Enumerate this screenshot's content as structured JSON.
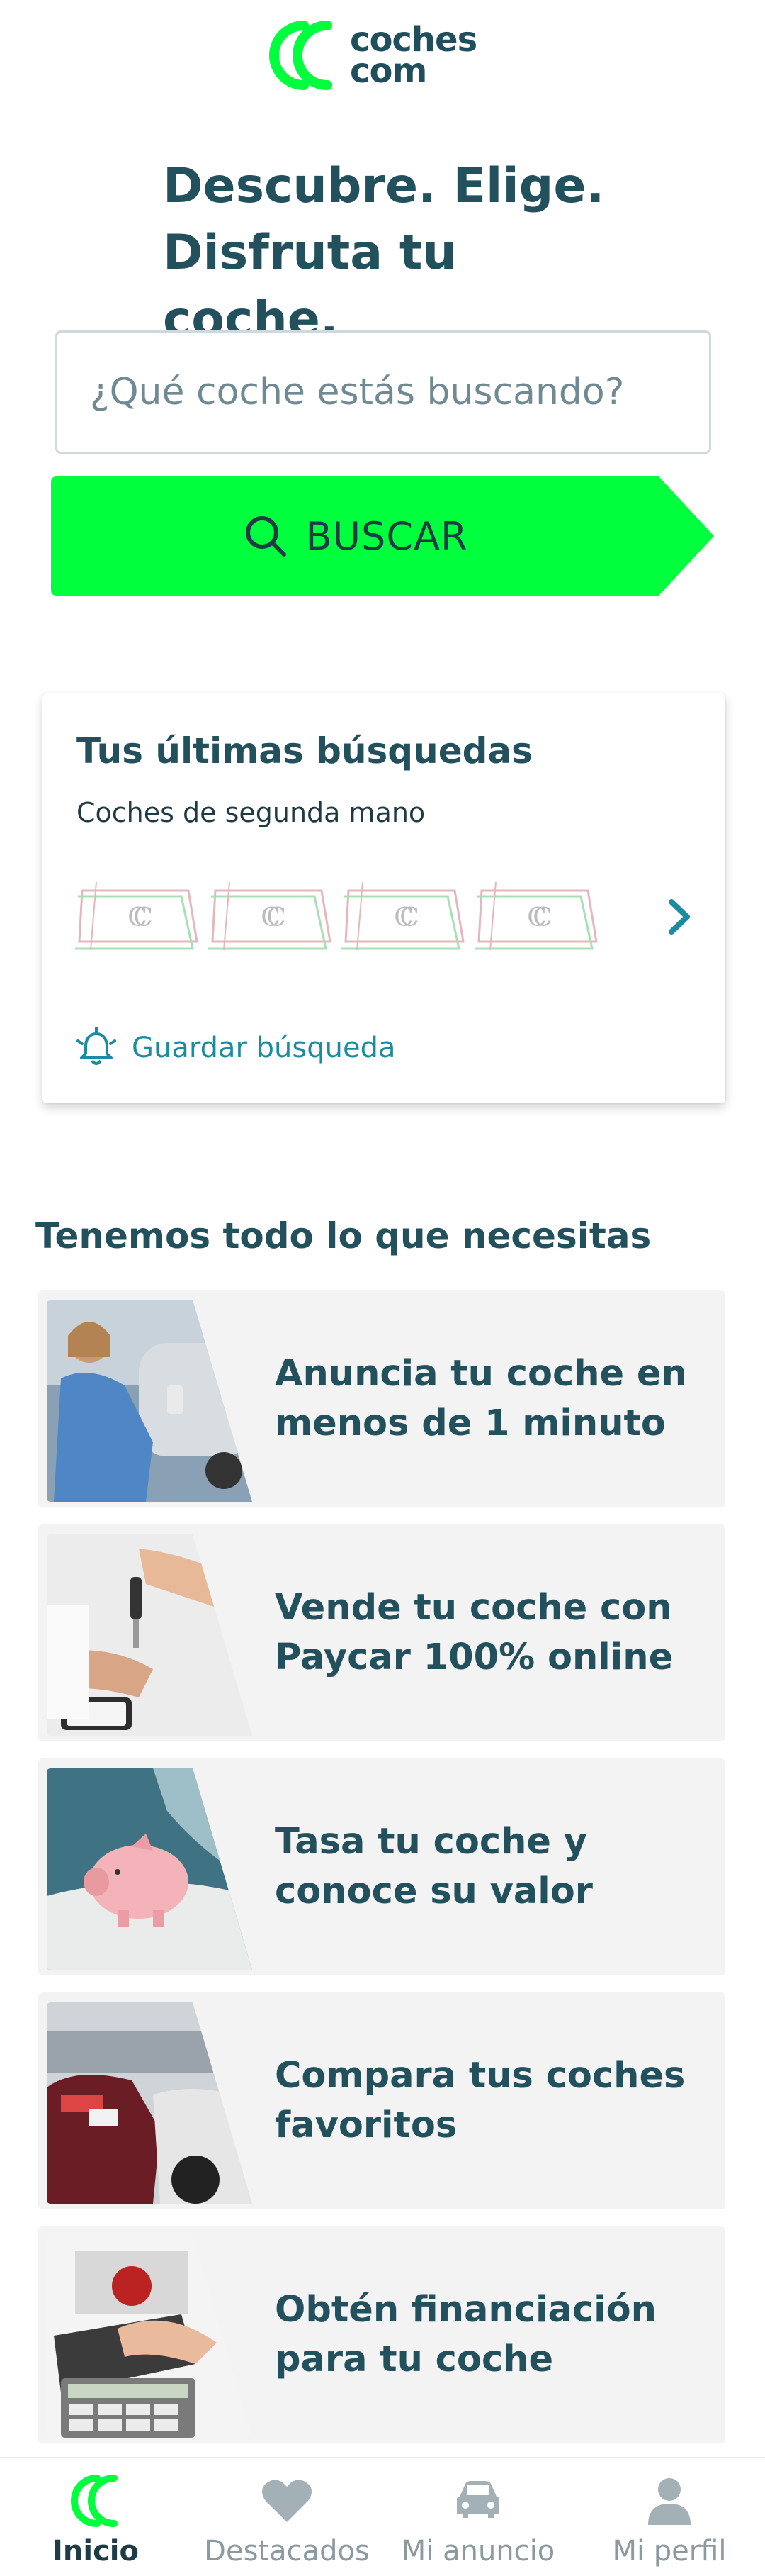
{
  "brand": {
    "logo_line1": "coches",
    "logo_line2": "com",
    "accent": "#00ff3c",
    "primary_text": "#22505c"
  },
  "hero": {
    "line1": "Descubre. Elige.",
    "line2": "Disfruta tu coche."
  },
  "search": {
    "placeholder": "¿Qué coche estás buscando?",
    "button_label": "BUSCAR"
  },
  "recent": {
    "title": "Tus últimas búsquedas",
    "subtitle": "Coches de segunda mano",
    "save_label": "Guardar búsqueda"
  },
  "features": {
    "title": "Tenemos todo lo que necesitas",
    "items": [
      {
        "line1": "Anuncia tu coche en",
        "line2": "menos de 1 minuto"
      },
      {
        "line1": "Vende tu coche con",
        "line2": "Paycar 100% online"
      },
      {
        "line1": "Tasa tu coche y",
        "line2": "conoce su valor"
      },
      {
        "line1": "Compara tus coches",
        "line2": "favoritos"
      },
      {
        "line1": "Obtén financiación",
        "line2": "para tu coche"
      }
    ]
  },
  "nav": {
    "items": [
      {
        "label": "Inicio",
        "icon": "home-logo-icon"
      },
      {
        "label": "Destacados",
        "icon": "heart-icon"
      },
      {
        "label": "Mi anuncio",
        "icon": "car-icon"
      },
      {
        "label": "Mi perfil",
        "icon": "user-icon"
      }
    ]
  }
}
